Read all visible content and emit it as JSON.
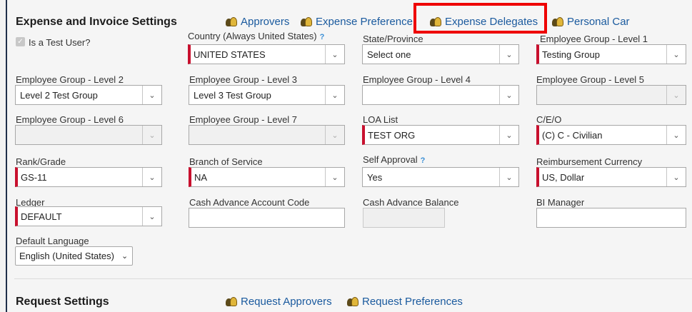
{
  "section1": {
    "title": "Expense and Invoice Settings",
    "links": [
      {
        "label": "Approvers",
        "icon": "people-icon"
      },
      {
        "label": "Expense Preference",
        "icon": "people-icon"
      },
      {
        "label": "Expense Delegates",
        "icon": "people-icon"
      },
      {
        "label": "Personal Car",
        "icon": "people-icon"
      }
    ],
    "highlight_color": "#ee0000"
  },
  "test_user": {
    "label": "Is a Test User?",
    "checked": true
  },
  "fields": {
    "country": {
      "label": "Country (Always United States)",
      "value": "UNITED STATES"
    },
    "state": {
      "label": "State/Province",
      "value": "Select one"
    },
    "eg1": {
      "label": "Employee Group - Level 1",
      "value": "Testing Group"
    },
    "eg2": {
      "label": "Employee Group - Level 2",
      "value": "Level 2 Test Group"
    },
    "eg3": {
      "label": "Employee Group - Level 3",
      "value": "Level 3 Test Group"
    },
    "eg4": {
      "label": "Employee Group - Level 4",
      "value": ""
    },
    "eg5": {
      "label": "Employee Group - Level 5",
      "value": ""
    },
    "eg6": {
      "label": "Employee Group - Level 6",
      "value": ""
    },
    "eg7": {
      "label": "Employee Group - Level 7",
      "value": ""
    },
    "loa": {
      "label": "LOA List",
      "value": "TEST ORG"
    },
    "ceo": {
      "label": "C/E/O",
      "value": "(C) C - Civilian"
    },
    "rank": {
      "label": "Rank/Grade",
      "value": "GS-11"
    },
    "branch": {
      "label": "Branch of Service",
      "value": "NA"
    },
    "self_approval": {
      "label": "Self Approval",
      "value": "Yes"
    },
    "currency": {
      "label": "Reimbursement Currency",
      "value": "US, Dollar"
    },
    "ledger": {
      "label": "Ledger",
      "value": "DEFAULT"
    },
    "cash_code": {
      "label": "Cash Advance Account Code",
      "value": ""
    },
    "cash_balance": {
      "label": "Cash Advance Balance",
      "value": ""
    },
    "bi_manager": {
      "label": "BI Manager",
      "value": ""
    },
    "language": {
      "label": "Default Language",
      "value": "English (United States)"
    }
  },
  "section2": {
    "title": "Request Settings",
    "links": [
      {
        "label": "Request Approvers",
        "icon": "people-icon"
      },
      {
        "label": "Request Preferences",
        "icon": "people-icon"
      }
    ]
  },
  "help_glyph": "?",
  "check_glyph": "✓",
  "caret_glyph": "⌄"
}
